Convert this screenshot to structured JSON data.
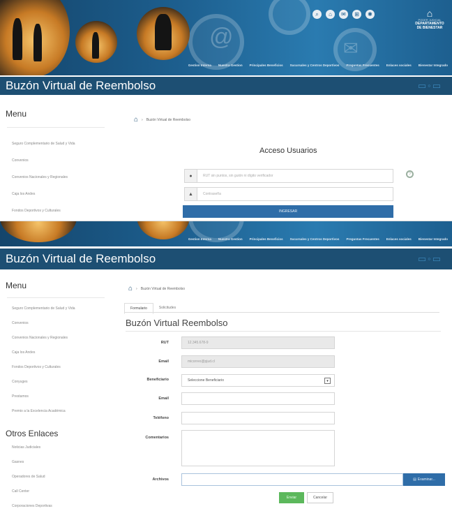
{
  "header": {
    "nav_items": [
      "Gestion Interna",
      "Nuestra Gestion",
      "Principales Beneficios",
      "Sucursales y Centros Deportivos",
      "Preguntas Frecuentes",
      "Enlaces sociales",
      "Bienestar Integrado"
    ],
    "top_icons": [
      "search-icon",
      "home-icon",
      "mail-icon",
      "sitemap-icon",
      "settings-icon"
    ],
    "dept_line1": "PODER JUDICIAL",
    "dept_line2": "DEPARTAMENTO",
    "dept_line3": "DE BIENESTAR"
  },
  "title": "Buzón Virtual de Reembolso",
  "screen1": {
    "menu_title": "Menu",
    "menu_items": [
      "Seguro Complementario de Salud y Vida",
      "Convenios",
      "Convenios Nacionales y Regionales",
      "Caja los Andes",
      "Fondos Deportivos y Culturales"
    ],
    "breadcrumb": "Buzón Virtual de Reembolso",
    "login_title": "Acceso Usuarios",
    "rut_placeholder": "RUT sin puntos, sin guión ni dígito verificador",
    "password_placeholder": "Contraseña",
    "login_button": "INGRESAR"
  },
  "screen2": {
    "menu_title": "Menu",
    "menu_items": [
      "Seguro Complementario de Salud y Vida",
      "Convenios",
      "Convenios Nacionales y Regionales",
      "Caja los Andes",
      "Fondos Deportivos y Culturales",
      "Conyuges",
      "Prestamos",
      "Premio a la Excelencia Académica"
    ],
    "otros_title": "Otros Enlaces",
    "otros_items": [
      "Noticias Judiciales",
      "Gasnes",
      "Operadores de Salud",
      "Call Center",
      "Corporaciones Deportivas"
    ],
    "breadcrumb": "Buzón Virtual de Reembolso",
    "tabs": [
      "Formulario",
      "Solicitudes"
    ],
    "form_title": "Buzón Virtual Reembolso",
    "labels": {
      "rut": "RUT",
      "email1": "Email",
      "beneficiario": "Beneficiario",
      "email2": "Email",
      "telefono": "Teléfono",
      "comentarios": "Comentarios",
      "archivos": "Archivos"
    },
    "rut_value": "12.345.678-9",
    "email_value": "micorreo@pjud.cl",
    "beneficiario_value": "Seleccione Beneficiario",
    "examinar_button": "Examinar...",
    "send_button": "Enviar",
    "cancel_button": "Cancelar"
  }
}
